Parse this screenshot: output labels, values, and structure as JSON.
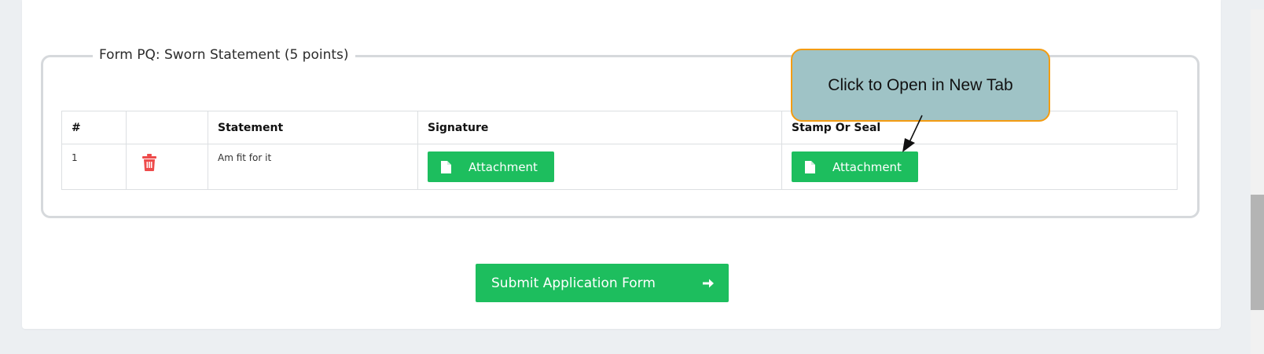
{
  "form_section": {
    "legend": "Form PQ: Sworn Statement (5 points)",
    "table": {
      "headers": [
        "#",
        "",
        "Statement",
        "Signature",
        "Stamp Or Seal"
      ],
      "rows": [
        {
          "num": "1",
          "action_icon": "trash-icon",
          "statement": "Am fit for it",
          "signature_label": "Attachment",
          "seal_label": "Attachment"
        }
      ]
    }
  },
  "submit_label": "Submit Application Form",
  "submit_icon": "arrow-right-icon",
  "callout": {
    "text": "Click to Open in New Tab"
  },
  "colors": {
    "accent_green": "#1dbe5e",
    "danger_red": "#ee4b4b",
    "callout_fill": "#9fc3c6",
    "callout_border": "#f39c12",
    "page_bg": "#eceff2"
  }
}
